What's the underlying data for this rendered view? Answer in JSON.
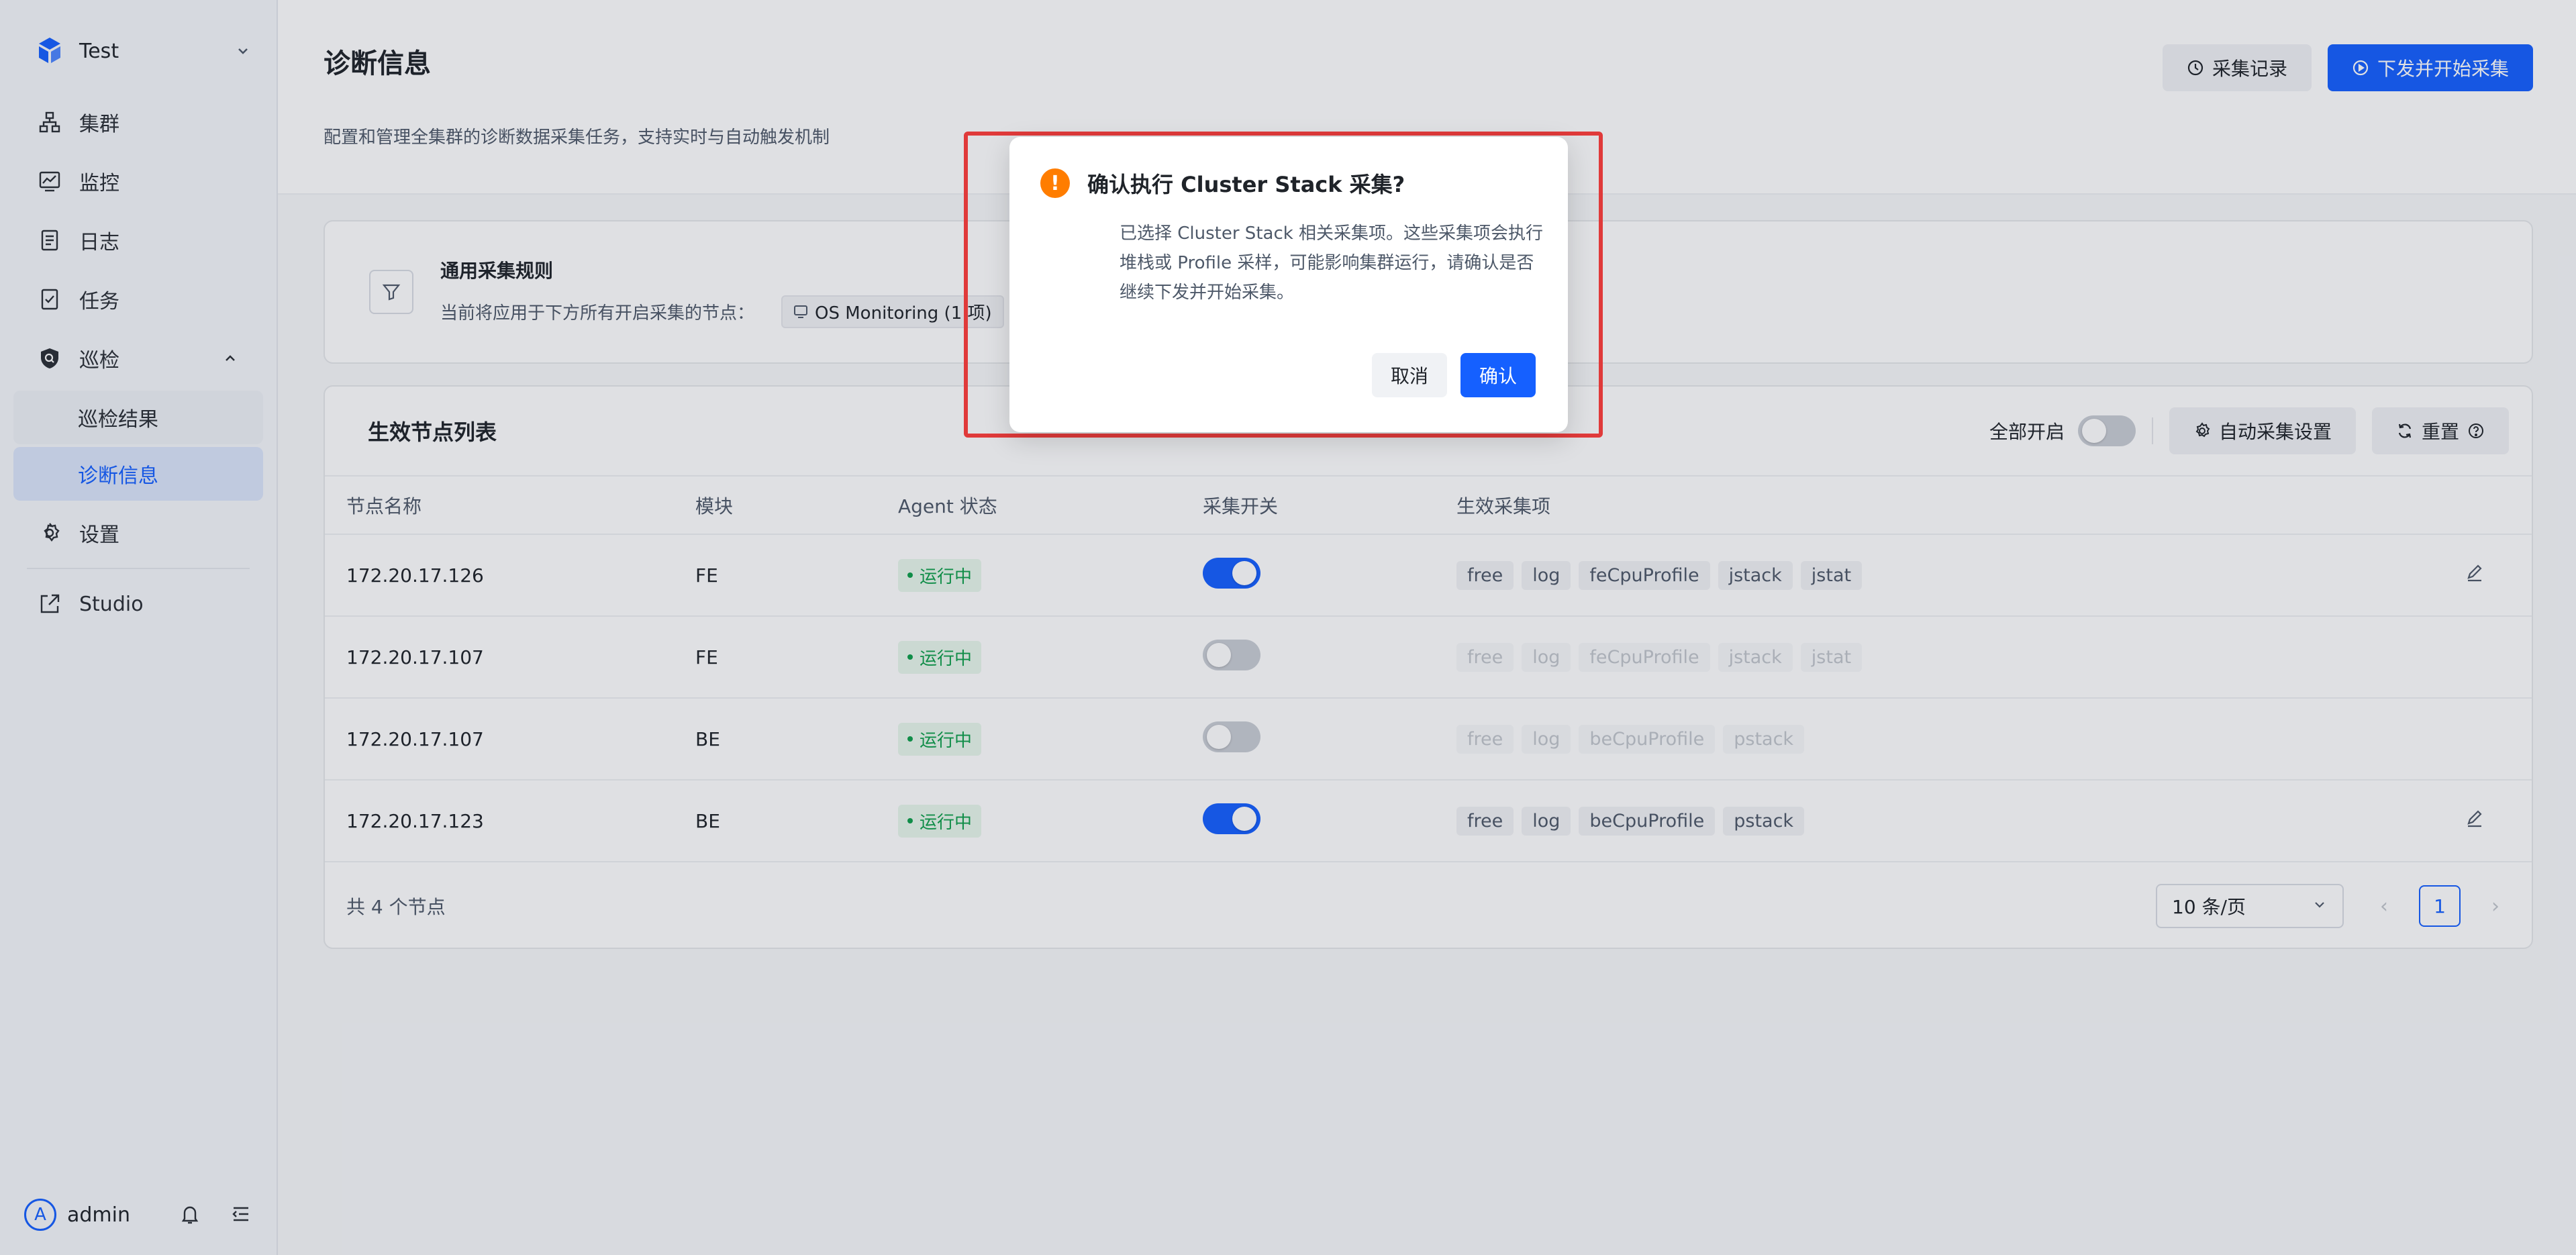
{
  "sidebar": {
    "project": "Test",
    "items": [
      {
        "label": "集群"
      },
      {
        "label": "监控"
      },
      {
        "label": "日志"
      },
      {
        "label": "任务"
      },
      {
        "label": "巡检"
      },
      {
        "label": "设置"
      },
      {
        "label": "Studio"
      }
    ],
    "sub_items": [
      {
        "label": "巡检结果"
      },
      {
        "label": "诊断信息"
      }
    ],
    "user": {
      "avatar_letter": "A",
      "name": "admin"
    }
  },
  "header": {
    "title": "诊断信息",
    "description": "配置和管理全集群的诊断数据采集任务，支持实时与自动触发机制",
    "history_button": "采集记录",
    "dispatch_button": "下发并开始采集"
  },
  "rule_card": {
    "title": "通用采集规则",
    "text": "当前将应用于下方所有开启采集的节点：",
    "tag": "OS Monitoring (1 项)"
  },
  "node_list": {
    "title": "生效节点列表",
    "enable_all_label": "全部开启",
    "enable_all_on": false,
    "auto_settings_button": "自动采集设置",
    "reset_button": "重置",
    "columns": [
      "节点名称",
      "模块",
      "Agent 状态",
      "采集开关",
      "生效采集项"
    ],
    "rows": [
      {
        "name": "172.20.17.126",
        "module": "FE",
        "status": "运行中",
        "enabled": true,
        "items": [
          "free",
          "log",
          "feCpuProfile",
          "jstack",
          "jstat"
        ]
      },
      {
        "name": "172.20.17.107",
        "module": "FE",
        "status": "运行中",
        "enabled": false,
        "items": [
          "free",
          "log",
          "feCpuProfile",
          "jstack",
          "jstat"
        ]
      },
      {
        "name": "172.20.17.107",
        "module": "BE",
        "status": "运行中",
        "enabled": false,
        "items": [
          "free",
          "log",
          "beCpuProfile",
          "pstack"
        ]
      },
      {
        "name": "172.20.17.123",
        "module": "BE",
        "status": "运行中",
        "enabled": true,
        "items": [
          "free",
          "log",
          "beCpuProfile",
          "pstack"
        ]
      }
    ],
    "total_text": "共 4 个节点",
    "page_size": "10 条/页",
    "current_page": "1"
  },
  "modal": {
    "title": "确认执行 Cluster Stack 采集?",
    "body": "已选择 Cluster Stack 相关采集项。这些采集项会执行堆栈或 Profile 采样，可能影响集群运行，请确认是否继续下发并开始采集。",
    "cancel": "取消",
    "confirm": "确认"
  },
  "colors": {
    "primary": "#1560ff",
    "success": "#0f9f4b",
    "warning": "#ff7d00",
    "highlight": "#e03a3a"
  }
}
